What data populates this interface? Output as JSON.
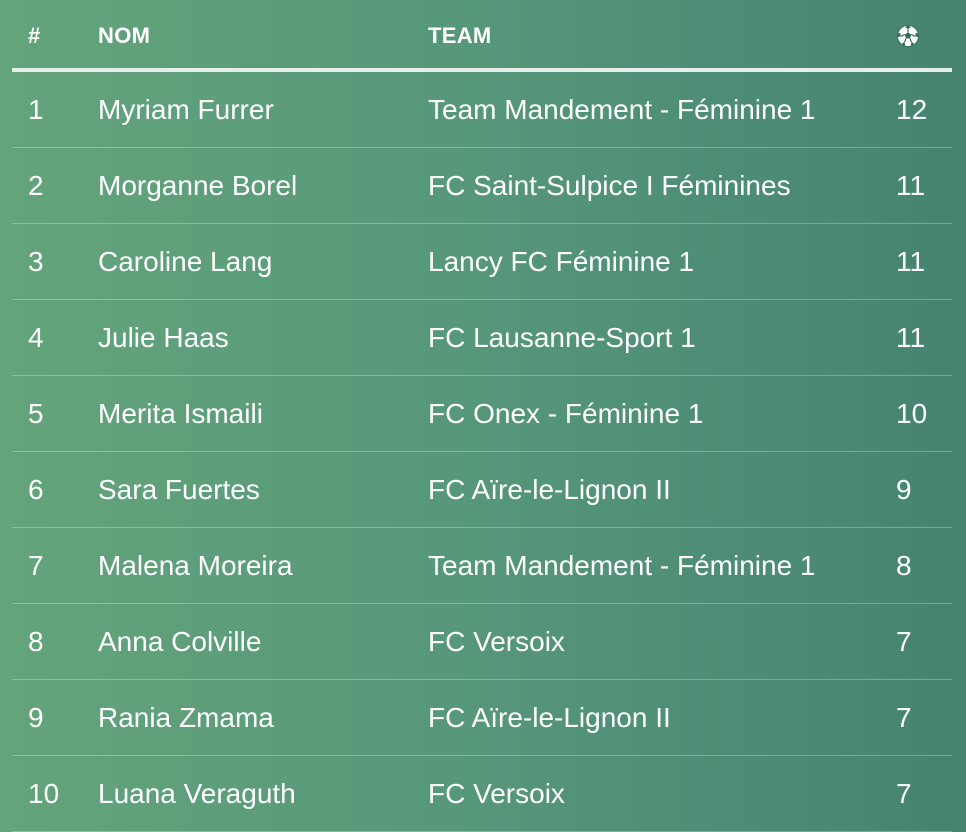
{
  "table": {
    "headers": {
      "rank": "#",
      "name": "NOM",
      "team": "TEAM",
      "goals_icon": "soccer-ball-icon"
    },
    "rows": [
      {
        "rank": "1",
        "name": "Myriam Furrer",
        "team": "Team Mandement - Féminine 1",
        "goals": "12"
      },
      {
        "rank": "2",
        "name": "Morganne Borel",
        "team": "FC Saint-Sulpice I Féminines",
        "goals": "11"
      },
      {
        "rank": "3",
        "name": "Caroline Lang",
        "team": "Lancy FC Féminine 1",
        "goals": "11"
      },
      {
        "rank": "4",
        "name": "Julie Haas",
        "team": "FC Lausanne-Sport 1",
        "goals": "11"
      },
      {
        "rank": "5",
        "name": "Merita Ismaili",
        "team": "FC Onex - Féminine 1",
        "goals": "10"
      },
      {
        "rank": "6",
        "name": "Sara Fuertes",
        "team": "FC Aïre-le-Lignon II",
        "goals": "9"
      },
      {
        "rank": "7",
        "name": "Malena Moreira",
        "team": "Team Mandement - Féminine 1",
        "goals": "8"
      },
      {
        "rank": "8",
        "name": "Anna Colville",
        "team": "FC Versoix",
        "goals": "7"
      },
      {
        "rank": "9",
        "name": "Rania Zmama",
        "team": "FC Aïre-le-Lignon II",
        "goals": "7"
      },
      {
        "rank": "10",
        "name": "Luana Veraguth",
        "team": "FC Versoix",
        "goals": "7"
      }
    ]
  },
  "colors": {
    "background_start": "#64a47b",
    "background_end": "#458370",
    "text": "#ffffff",
    "header_rule": "#e4eeea"
  }
}
